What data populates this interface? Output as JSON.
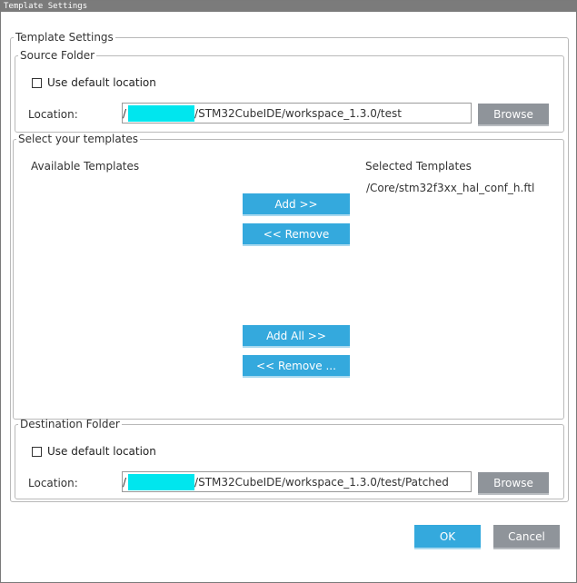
{
  "window": {
    "title": "Template Settings"
  },
  "main_group": {
    "legend": "Template Settings"
  },
  "source_folder": {
    "legend": "Source Folder",
    "use_default_label": "Use default location",
    "location_label": "Location:",
    "path_prefix": "/",
    "path_suffix": "/STM32CubeIDE/workspace_1.3.0/test",
    "browse_label": "Browse"
  },
  "templates": {
    "legend": "Select your templates",
    "available_header": "Available Templates",
    "selected_header": "Selected Templates",
    "available_items": [],
    "selected_items": [
      "/Core/stm32f3xx_hal_conf_h.ftl"
    ],
    "add_label": "Add >>",
    "remove_label": "<< Remove",
    "add_all_label": "Add All >>",
    "remove_all_label": "<< Remove ..."
  },
  "destination_folder": {
    "legend": "Destination Folder",
    "use_default_label": "Use default location",
    "location_label": "Location:",
    "path_prefix": "/",
    "path_suffix": "/STM32CubeIDE/workspace_1.3.0/test/Patched",
    "browse_label": "Browse"
  },
  "footer": {
    "ok_label": "OK",
    "cancel_label": "Cancel"
  },
  "colors": {
    "accent": "#34a9dd",
    "neutral_button": "#8f949a",
    "redaction": "#00e6ee",
    "titlebar": "#7b7b7b"
  }
}
